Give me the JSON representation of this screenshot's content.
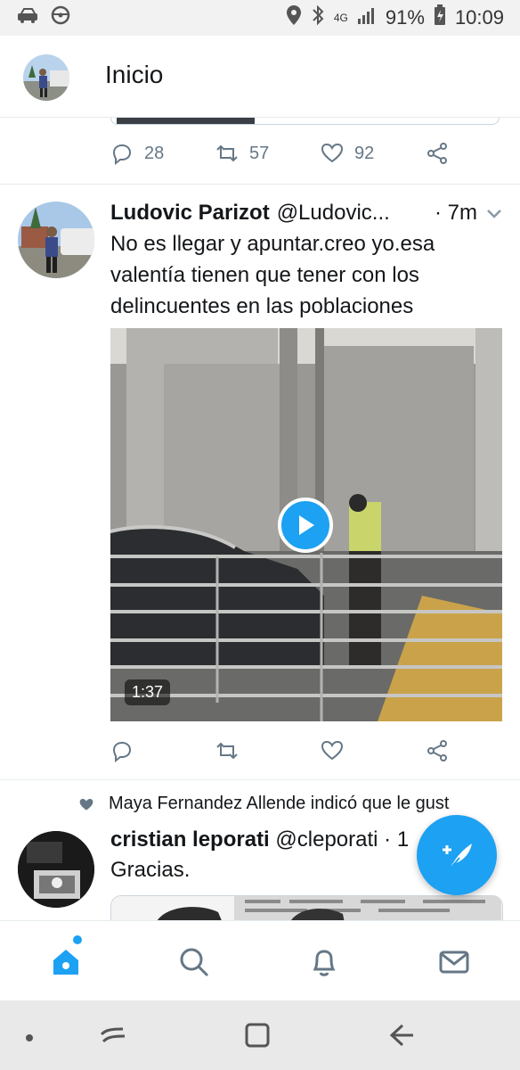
{
  "status_bar": {
    "network_label": "4G",
    "battery_percent": "91%",
    "time": "10:09",
    "icons": [
      "car-icon",
      "steering-wheel-icon",
      "location-icon",
      "bluetooth-icon",
      "signal-icon",
      "battery-icon"
    ]
  },
  "header": {
    "title": "Inicio"
  },
  "prev_tweet": {
    "actions": {
      "replies": "28",
      "retweets": "57",
      "likes": "92"
    }
  },
  "tweet1": {
    "name": "Ludovic Parizot",
    "handle": "@Ludovic...",
    "time": "· 7m",
    "text": "No es llegar y apuntar.creo yo.esa valentía tienen que tener con los delincuentes en las poblaciones",
    "video_duration": "1:37"
  },
  "liked_notice": {
    "text": "Maya Fernandez Allende indicó que le gust"
  },
  "tweet2": {
    "name": "cristian leporati",
    "handle": "@cleporati",
    "time": "· 1",
    "text": "Gracias."
  },
  "colors": {
    "accent": "#1da1f2",
    "text": "#14171a",
    "secondary": "#657786",
    "divider": "#e6ecf0"
  },
  "bottom_nav": [
    "home-icon",
    "search-icon",
    "notifications-icon",
    "messages-icon"
  ],
  "system_nav": [
    "dot-icon",
    "recents-icon",
    "home-square-icon",
    "back-icon"
  ]
}
